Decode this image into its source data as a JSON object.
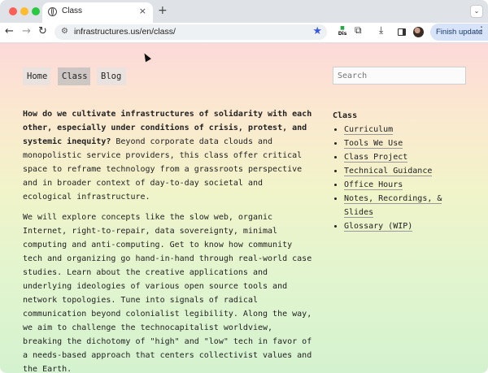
{
  "browser": {
    "tab_title": "Class",
    "tab_close": "×",
    "new_tab": "+",
    "url": "infrastructures.us/en/class/",
    "update_button": "Finish update",
    "extension_dis_top": "Dis",
    "more_menu": "⋮"
  },
  "nav": {
    "home": "Home",
    "class": "Class",
    "blog": "Blog"
  },
  "search": {
    "placeholder": "Search"
  },
  "article": {
    "intro_bold": "How do we cultivate infrastructures of solidarity with each other, especially under conditions of crisis, protest, and systemic inequity?",
    "intro_rest": " Beyond corporate data clouds and monopolistic service providers, this class offer critical space to reframe technology from a grassroots perspective and in broader context of day-to-day societal and ecological infrastructure.",
    "para2": "We will explore concepts like the slow web, organic Internet, right-to-repair, data sovereignty, minimal computing and anti-computing. Get to know how community tech and organizing go hand-in-hand through real-world case studies. Learn about the creative applications and underlying ideologies of various open source tools and network topologies. Tune into signals of radical communication beyond colonialist legibility. Along the way, we aim to challenge the technocapitalist worldview, breaking the dichotomy of \"high\" and \"low\" tech in favor of a needs-based approach that centers collectivist values and the Earth."
  },
  "aside": {
    "title": "Class",
    "links": [
      "Curriculum",
      "Tools We Use",
      "Class Project",
      "Technical Guidance",
      "Office Hours",
      "Notes, Recordings, & Slides",
      "Glossary (WIP)"
    ]
  },
  "colors": {
    "page_top": "#fcd9d9",
    "page_bottom": "#d4f2cf",
    "accent_star": "#3a5bd9"
  },
  "icons": [
    "back-arrow-icon",
    "forward-arrow-icon",
    "reload-icon",
    "site-info-icon",
    "bookmark-star-icon",
    "puzzle-icon",
    "download-icon",
    "side-panel-icon",
    "profile-avatar",
    "kebab-menu-icon"
  ]
}
